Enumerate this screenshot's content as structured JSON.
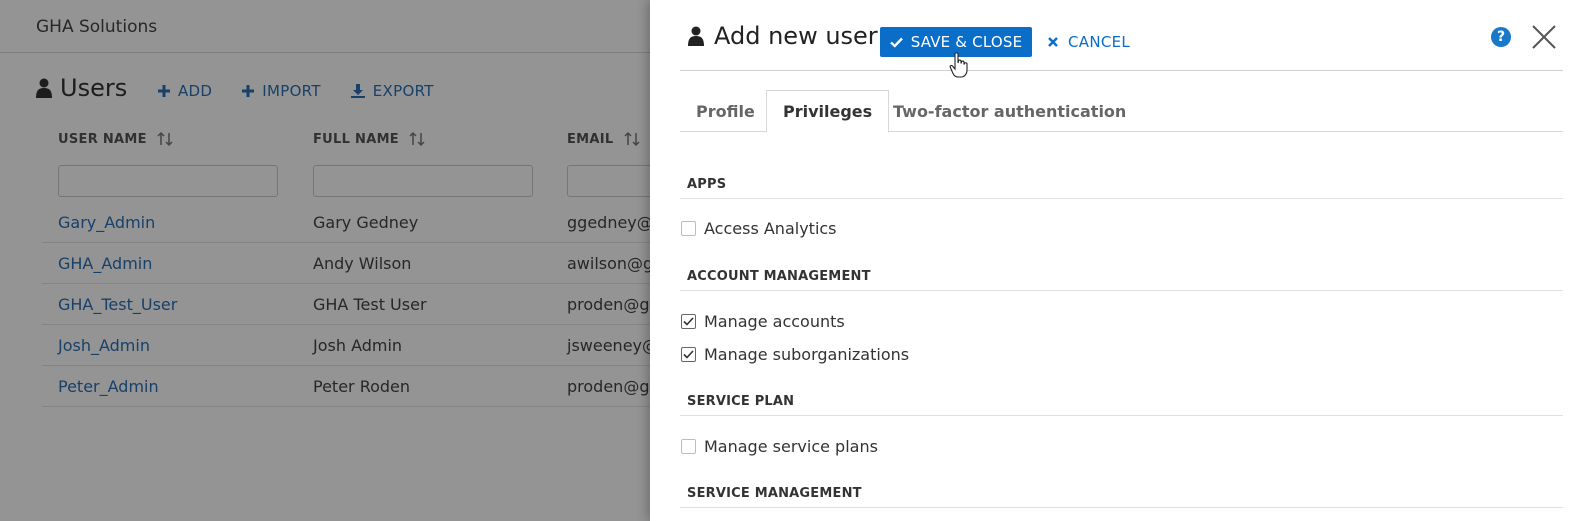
{
  "background": {
    "brand": "GHA Solutions",
    "page_title": "Users",
    "actions": [
      {
        "label": "ADD",
        "icon": "plus-icon"
      },
      {
        "label": "IMPORT",
        "icon": "plus-icon"
      },
      {
        "label": "EXPORT",
        "icon": "download-icon"
      }
    ],
    "columns": [
      "USER NAME",
      "FULL NAME",
      "EMAIL"
    ],
    "rows": [
      {
        "username": "Gary_Admin",
        "fullname": "Gary Gedney",
        "email": "ggedney@g"
      },
      {
        "username": "GHA_Admin",
        "fullname": "Andy Wilson",
        "email": "awilson@gh"
      },
      {
        "username": "GHA_Test_User",
        "fullname": "GHA Test User",
        "email": "proden@gh"
      },
      {
        "username": "Josh_Admin",
        "fullname": "Josh Admin",
        "email": "jsweeney@"
      },
      {
        "username": "Peter_Admin",
        "fullname": "Peter Roden",
        "email": "proden@gh"
      }
    ]
  },
  "panel": {
    "title": "Add new user",
    "save_label": "SAVE & CLOSE",
    "cancel_label": "CANCEL",
    "help_glyph": "?",
    "tabs": [
      "Profile",
      "Privileges",
      "Two-factor authentication"
    ],
    "active_tab": "Privileges",
    "sections": [
      {
        "title": "APPS",
        "items": [
          {
            "label": "Access Analytics",
            "checked": false
          }
        ]
      },
      {
        "title": "ACCOUNT MANAGEMENT",
        "items": [
          {
            "label": "Manage accounts",
            "checked": true
          },
          {
            "label": "Manage suborganizations",
            "checked": true
          }
        ]
      },
      {
        "title": "SERVICE PLAN",
        "items": [
          {
            "label": "Manage service plans",
            "checked": false
          }
        ]
      },
      {
        "title": "SERVICE MANAGEMENT",
        "items": []
      }
    ]
  },
  "colors": {
    "accent": "#0a6dc7",
    "link": "#2a6fb5",
    "overlay": "rgba(0,0,0,0.42)"
  }
}
